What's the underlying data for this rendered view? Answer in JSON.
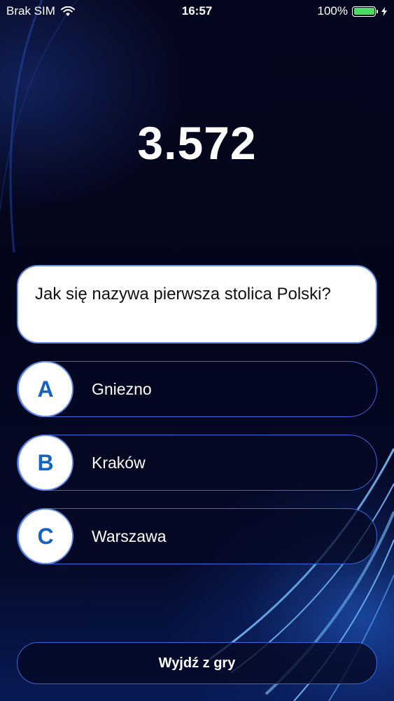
{
  "status_bar": {
    "carrier": "Brak SIM",
    "time": "16:57",
    "battery_percent": "100%",
    "battery_level": 1.0,
    "battery_color": "#4cd964",
    "icons": [
      "wifi-icon",
      "battery-icon",
      "charging-bolt-icon"
    ]
  },
  "game": {
    "score": "3.572",
    "question": "Jak się nazywa pierwsza stolica Polski?",
    "answers": [
      {
        "letter": "A",
        "text": "Gniezno"
      },
      {
        "letter": "B",
        "text": "Kraków"
      },
      {
        "letter": "C",
        "text": "Warszawa"
      }
    ],
    "exit_label": "Wyjdź z gry"
  },
  "colors": {
    "accent": "#1563c2",
    "outline": "#3a66d8",
    "background": "#03051a"
  }
}
